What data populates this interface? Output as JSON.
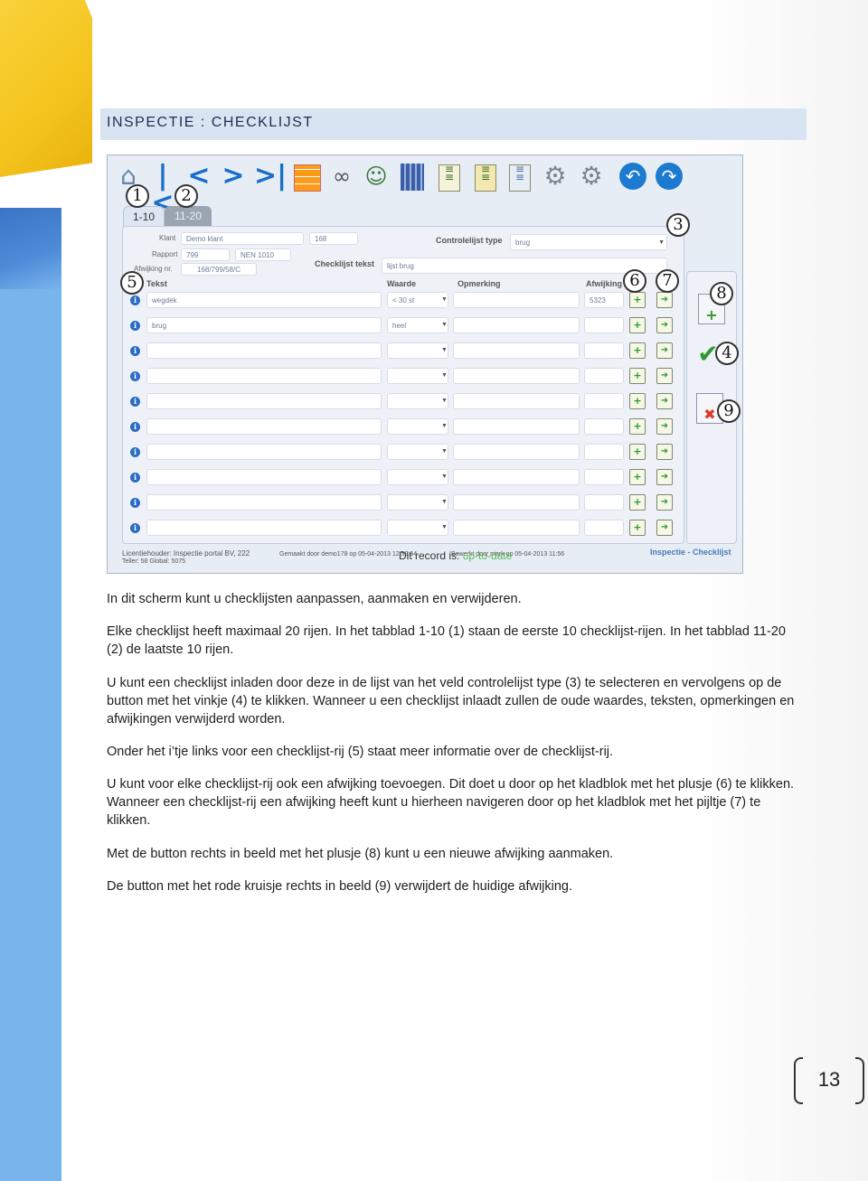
{
  "header": {
    "title": "INSPECTIE : CHECKLIJST"
  },
  "screenshot": {
    "tabs": [
      "1-10",
      "11-20"
    ],
    "callouts": [
      "1",
      "2",
      "3",
      "4",
      "5",
      "6",
      "7",
      "8",
      "9"
    ],
    "fields": {
      "klant_label": "Klant",
      "klant_value": "Demo klant",
      "klant_number": "168",
      "rapport_label": "Rapport",
      "rapport_value": "799",
      "rapport_norm": "NEN 1010",
      "afwijking_label": "Afwijking nr.",
      "afwijking_value": "168/799/58/C",
      "controlelijst_label": "Controlelijst type",
      "controlelijst_value": "brug",
      "checklijst_tekst_label": "Checklijst tekst",
      "checklijst_tekst_value": "lijst brug"
    },
    "columns": [
      "Tekst",
      "Waarde",
      "Opmerking",
      "Afwijking"
    ],
    "rows": [
      {
        "tekst": "wegdek",
        "waarde": "< 30 st",
        "opmerking": "",
        "afwijking": "5323"
      },
      {
        "tekst": "brug",
        "waarde": "heel",
        "opmerking": "",
        "afwijking": ""
      },
      {
        "tekst": "",
        "waarde": "",
        "opmerking": "",
        "afwijking": ""
      },
      {
        "tekst": "",
        "waarde": "",
        "opmerking": "",
        "afwijking": ""
      },
      {
        "tekst": "",
        "waarde": "",
        "opmerking": "",
        "afwijking": ""
      },
      {
        "tekst": "",
        "waarde": "",
        "opmerking": "",
        "afwijking": ""
      },
      {
        "tekst": "",
        "waarde": "",
        "opmerking": "",
        "afwijking": ""
      },
      {
        "tekst": "",
        "waarde": "",
        "opmerking": "",
        "afwijking": ""
      },
      {
        "tekst": "",
        "waarde": "",
        "opmerking": "",
        "afwijking": ""
      },
      {
        "tekst": "",
        "waarde": "",
        "opmerking": "",
        "afwijking": ""
      }
    ],
    "footer": {
      "licentie": "Licentiehouder: Inspectie portal BV, 222",
      "teller": "Teller:      58    Global:       5075",
      "gemaakt": "Gemaakt door demo178 op 05-04-2013 12:59:54",
      "gewijzigd": "Bewerkt door mark op 05-04-2013 11:56",
      "status_prefix": "Dit record is:",
      "status_value": "up-to-date",
      "screen_name": "Inspectie - Checklijst"
    }
  },
  "paragraphs": [
    "In dit scherm kunt u checklijsten aanpassen, aanmaken en verwijderen.",
    "Elke checklijst heeft maximaal 20 rijen. In het tabblad 1-10 (1) staan de eerste 10 checklijst-rijen. In het tabblad 11-20 (2) de laatste 10 rijen.",
    "U kunt een checklijst inladen door deze in de lijst van het veld controlelijst type (3) te selecteren en vervolgens op de button met het vinkje (4) te klikken. Wanneer u een checklijst inlaadt zullen de oude waardes, teksten, opmerkingen en afwijkingen verwijderd worden.",
    "Onder het i’tje links voor een checklijst-rij (5) staat meer informatie over de checklijst-rij.",
    "U kunt voor elke checklijst-rij ook een afwijking toevoegen. Dit doet u door op het kladblok met het plusje (6) te klikken. Wanneer een checklijst-rij een afwijking heeft kunt u hierheen navigeren door op het kladblok met het pijltje (7) te klikken.",
    "Met de button rechts in beeld met het plusje (8) kunt u een nieuwe afwijking aanmaken.",
    "De button met het rode kruisje rechts in beeld (9) verwijdert de huidige afwijking."
  ],
  "page_number": "13",
  "icons": [
    "home-icon",
    "first-icon",
    "prev-icon",
    "next-icon",
    "last-icon",
    "grid-icon",
    "binoculars-icon",
    "users-icon",
    "building-icon",
    "doc-green-icon",
    "doc-yellow-icon",
    "doc-blue-icon",
    "gear-warning-icon",
    "gear-icon",
    "back-icon",
    "forward-icon",
    "info-icon",
    "notepad-plus-icon",
    "notepad-arrow-icon",
    "new-doc-icon",
    "checkmark-icon",
    "delete-doc-icon"
  ]
}
